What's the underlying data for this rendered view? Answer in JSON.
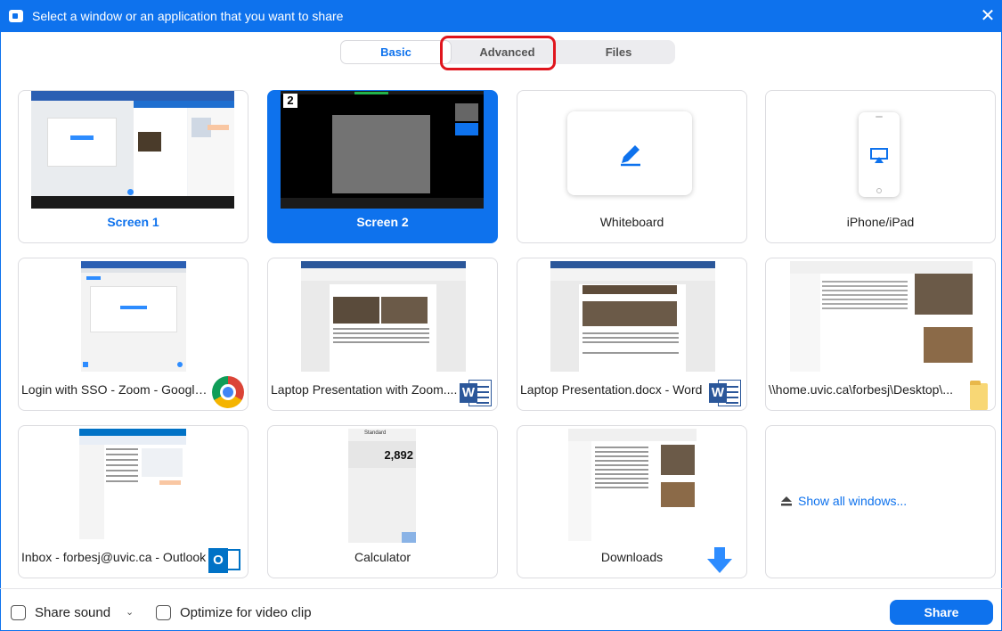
{
  "window": {
    "title": "Select a window or an application that you want to share",
    "close_glyph": "✕"
  },
  "tabs": [
    {
      "label": "Basic",
      "active": true
    },
    {
      "label": "Advanced",
      "active": false
    },
    {
      "label": "Files",
      "active": false
    }
  ],
  "screens": [
    {
      "label": "Screen 1",
      "selected": false
    },
    {
      "label": "Screen 2",
      "selected": true,
      "badge": "2"
    }
  ],
  "tools": [
    {
      "label": "Whiteboard",
      "icon": "pencil-icon"
    },
    {
      "label": "iPhone/iPad",
      "icon": "airplay-icon"
    }
  ],
  "windows": [
    {
      "label": "Login with SSO - Zoom - Google ...",
      "app_icon": "chrome-icon"
    },
    {
      "label": "Laptop Presentation with Zoom....",
      "app_icon": "word-icon"
    },
    {
      "label": "Laptop Presentation.docx - Word",
      "app_icon": "word-icon"
    },
    {
      "label": "\\\\home.uvic.ca\\forbesj\\Desktop\\...",
      "app_icon": "folder-icon"
    },
    {
      "label": "Inbox - forbesj@uvic.ca - Outlook",
      "app_icon": "outlook-icon"
    },
    {
      "label": "Calculator",
      "app_icon": "calculator-icon",
      "display": "2,892",
      "mode": "Standard"
    },
    {
      "label": "Downloads",
      "app_icon": "download-arrow-icon"
    }
  ],
  "show_all": {
    "label": "Show all windows...",
    "icon": "eject-icon"
  },
  "footer": {
    "share_sound": "Share sound",
    "caret": "⌄",
    "optimize_video": "Optimize for video clip",
    "share_button": "Share"
  },
  "colors": {
    "accent": "#0e72ed",
    "annotation": "#e0151d"
  }
}
